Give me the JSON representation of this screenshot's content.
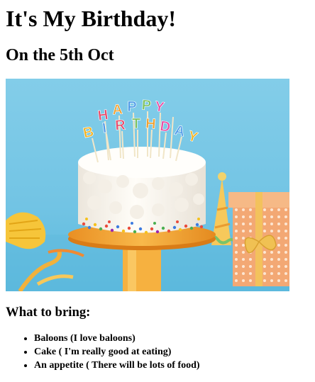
{
  "heading": {
    "title": "It's My Birthday!",
    "subtitle": "On the 5th Oct"
  },
  "cake_letters": [
    "H",
    "A",
    "P",
    "P",
    "Y",
    "B",
    "I",
    "R",
    "T",
    "H",
    "D",
    "A",
    "Y"
  ],
  "bring": {
    "heading": "What to bring:",
    "items": [
      "Baloons (I love baloons)",
      "Cake ( I'm really good at eating)",
      "An appetite ( There will be lots of food)"
    ]
  },
  "colors": {
    "background": "#7fcbe8",
    "frosting": "#fbf8f2",
    "plate": "#f3a93d",
    "gift": "#f2b27c"
  }
}
